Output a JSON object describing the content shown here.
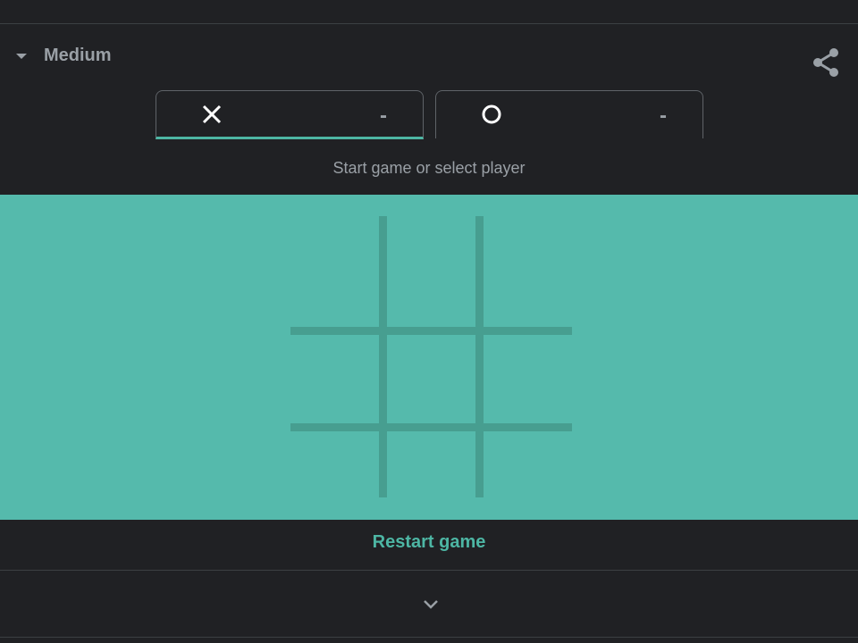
{
  "header": {
    "difficulty_label": "Medium",
    "difficulty_icon": "caret-down-icon",
    "share_icon": "share-icon"
  },
  "players": [
    {
      "symbol": "X",
      "score": "-",
      "active": true
    },
    {
      "symbol": "O",
      "score": "-",
      "active": false
    }
  ],
  "status_text": "Start game or select player",
  "board": {
    "cells": [
      "",
      "",
      "",
      "",
      "",
      "",
      "",
      "",
      ""
    ]
  },
  "restart_label": "Restart game",
  "expand_icon": "chevron-down-icon",
  "colors": {
    "background": "#202124",
    "board": "#55baac",
    "grid_line": "#479e90",
    "accent": "#4db6a4",
    "muted_text": "#9aa0a6"
  }
}
